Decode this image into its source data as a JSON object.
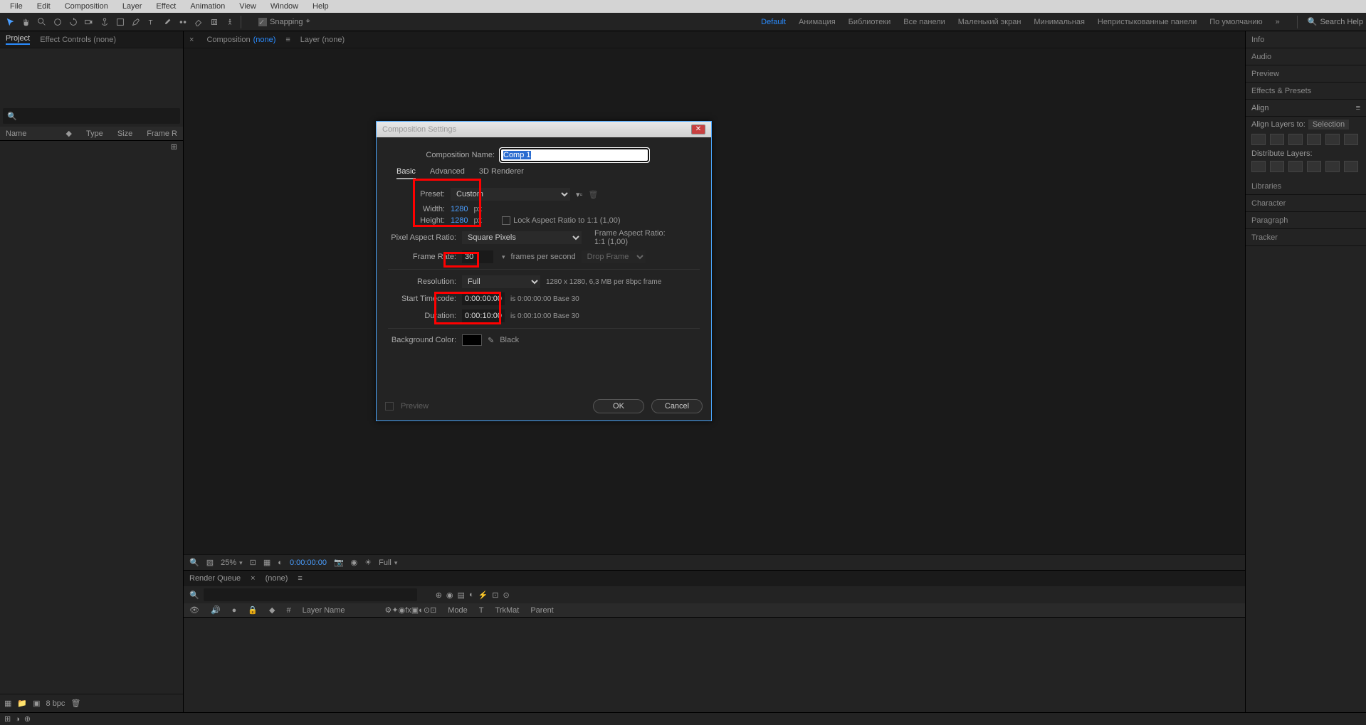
{
  "menu": {
    "items": [
      "File",
      "Edit",
      "Composition",
      "Layer",
      "Effect",
      "Animation",
      "View",
      "Window",
      "Help"
    ]
  },
  "toolbar": {
    "snapping": "Snapping",
    "search_help": "Search Help"
  },
  "workspaces": {
    "active": "Default",
    "items": [
      "Default",
      "Анимация",
      "Библиотеки",
      "Все панели",
      "Маленький экран",
      "Минимальная",
      "Непристыкованные панели",
      "По умолчанию"
    ]
  },
  "left": {
    "tabs": {
      "project": "Project",
      "effect_controls": "Effect Controls (none)"
    },
    "cols": {
      "name": "Name",
      "type": "Type",
      "size": "Size",
      "frame": "Frame R"
    },
    "footer": {
      "bpc": "8 bpc"
    }
  },
  "center": {
    "tabs": {
      "comp": "Composition",
      "comp_name": "(none)",
      "layer": "Layer (none)"
    },
    "footer": {
      "zoom": "25%",
      "time": "0:00:00:00",
      "full": "Full"
    }
  },
  "right": {
    "sections": [
      "Info",
      "Audio",
      "Preview",
      "Effects & Presets",
      "Align",
      "Libraries",
      "Character",
      "Paragraph",
      "Tracker"
    ],
    "align": {
      "to_label": "Align Layers to:",
      "to_value": "Selection",
      "distribute": "Distribute Layers:"
    }
  },
  "timeline": {
    "tabs": {
      "rq": "Render Queue",
      "none": "(none)"
    },
    "cols": {
      "num": "#",
      "layer": "Layer Name",
      "mode": "Mode",
      "t": "T",
      "trkmat": "TrkMat",
      "parent": "Parent"
    }
  },
  "dialog": {
    "title": "Composition Settings",
    "name_label": "Composition Name:",
    "name_value": "Comp 1",
    "tabs": [
      "Basic",
      "Advanced",
      "3D Renderer"
    ],
    "preset_label": "Preset:",
    "preset_value": "Custom",
    "width_label": "Width:",
    "width_value": "1280",
    "height_label": "Height:",
    "height_value": "1280",
    "px": "px",
    "lock_ar": "Lock Aspect Ratio to 1:1 (1,00)",
    "par_label": "Pixel Aspect Ratio:",
    "par_value": "Square Pixels",
    "far_label": "Frame Aspect Ratio:",
    "far_value": "1:1 (1,00)",
    "fps_label": "Frame Rate:",
    "fps_value": "30",
    "fps_suffix": "frames per second",
    "drop": "Drop Frame",
    "res_label": "Resolution:",
    "res_value": "Full",
    "res_info": "1280 x 1280, 6,3 MB per 8bpc frame",
    "start_label": "Start Timecode:",
    "start_value": "0:00:00:00",
    "start_info": "is 0:00:00:00  Base 30",
    "dur_label": "Duration:",
    "dur_value": "0:00:10:00",
    "dur_info": "is 0:00:10:00  Base 30",
    "bg_label": "Background Color:",
    "bg_name": "Black",
    "preview": "Preview",
    "ok": "OK",
    "cancel": "Cancel"
  }
}
